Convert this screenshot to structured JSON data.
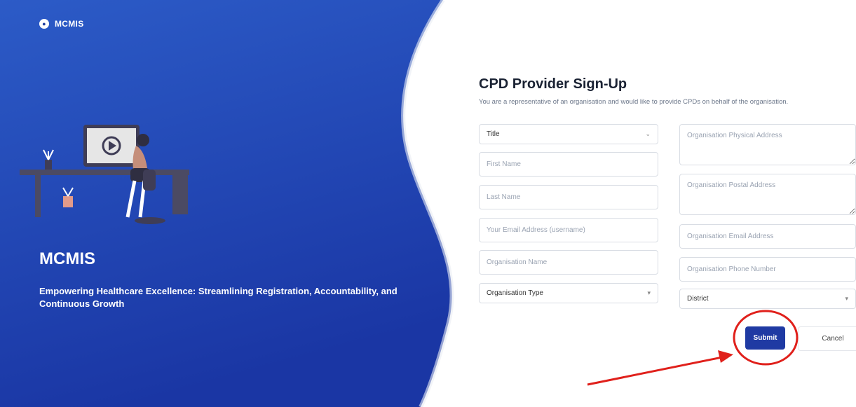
{
  "brand": {
    "name": "MCMIS",
    "icon": "globe-icon"
  },
  "hero": {
    "title": "MCMIS",
    "tagline": "Empowering Healthcare Excellence: Streamlining Registration, Accountability, and Continuous Growth"
  },
  "form": {
    "title": "CPD Provider Sign-Up",
    "subtitle": "You are a representative of an organisation and would like to provide CPDs on behalf of the organisation.",
    "title_select": "Title",
    "first_name_placeholder": "First Name",
    "last_name_placeholder": "Last Name",
    "email_placeholder": "Your Email Address (username)",
    "org_name_placeholder": "Organisation Name",
    "org_type_select": "Organisation Type",
    "org_physical_placeholder": "Organisation Physical Address",
    "org_postal_placeholder": "Organisation Postal Address",
    "org_email_placeholder": "Organisation Email Address",
    "org_phone_placeholder": "Organisation Phone Number",
    "district_select": "District",
    "submit_label": "Submit",
    "cancel_label": "Cancel"
  },
  "colors": {
    "hero_gradient_start": "#2d5cc8",
    "hero_gradient_end": "#1a37a6",
    "primary": "#1f3aa3",
    "annotation": "#e0201b"
  }
}
